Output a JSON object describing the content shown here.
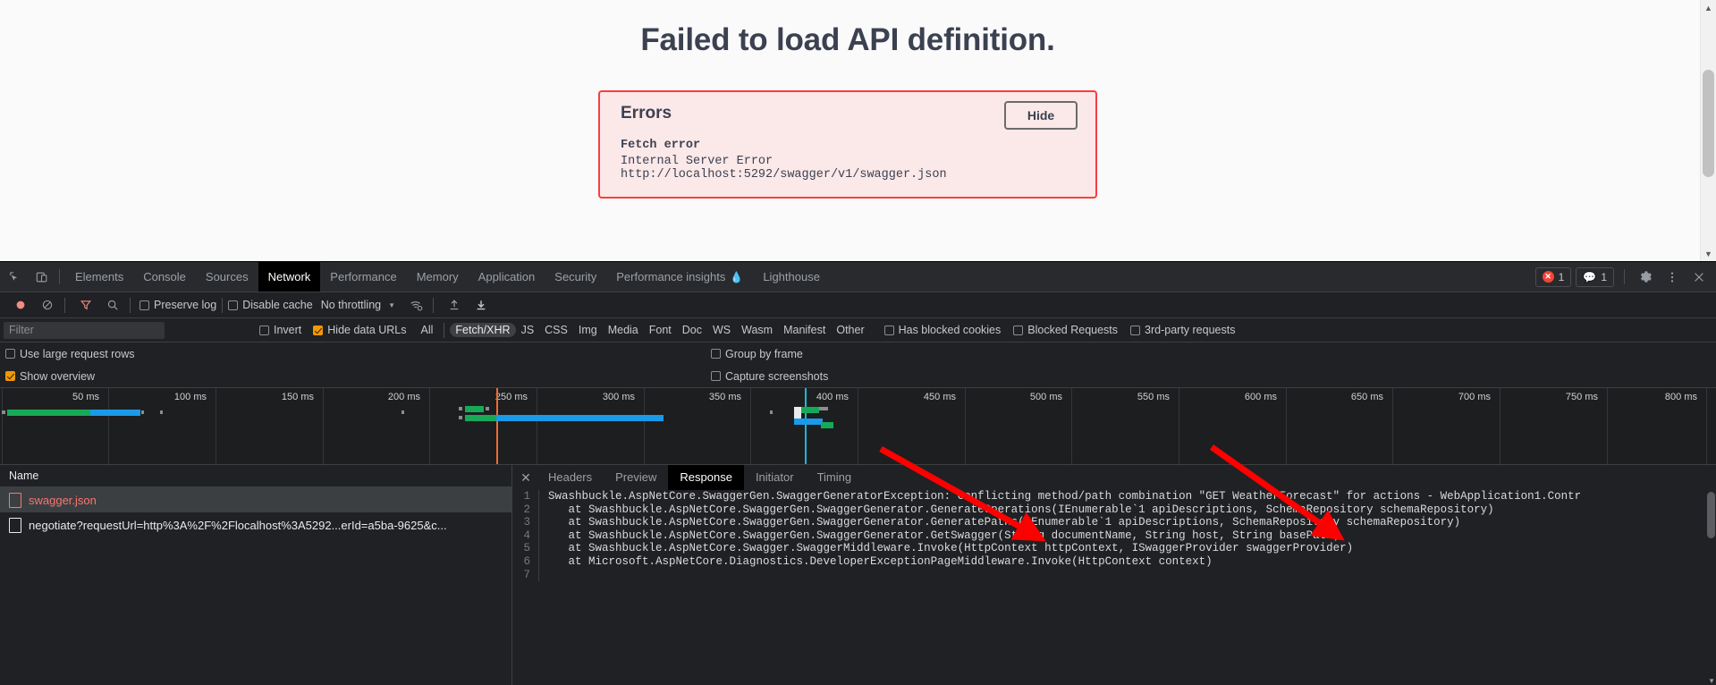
{
  "page": {
    "title": "Failed to load API definition.",
    "errors_panel": {
      "heading": "Errors",
      "hide_button": "Hide",
      "error_label": "Fetch error",
      "error_detail": "Internal Server Error http://localhost:5292/swagger/v1/swagger.json"
    }
  },
  "devtools": {
    "tabs": [
      {
        "label": "Elements",
        "active": false
      },
      {
        "label": "Console",
        "active": false
      },
      {
        "label": "Sources",
        "active": false
      },
      {
        "label": "Network",
        "active": true
      },
      {
        "label": "Performance",
        "active": false
      },
      {
        "label": "Memory",
        "active": false
      },
      {
        "label": "Application",
        "active": false
      },
      {
        "label": "Security",
        "active": false
      },
      {
        "label": "Performance insights",
        "active": false,
        "beaker": "⚗"
      },
      {
        "label": "Lighthouse",
        "active": false
      }
    ],
    "status": {
      "error_count": "1",
      "message_count": "1"
    },
    "network_toolbar": {
      "preserve_log": {
        "label": "Preserve log",
        "checked": false
      },
      "disable_cache": {
        "label": "Disable cache",
        "checked": false
      },
      "throttling": "No throttling"
    },
    "filter_bar": {
      "filter_placeholder": "Filter",
      "filter_value": "",
      "invert": {
        "label": "Invert",
        "checked": false
      },
      "hide_data_urls": {
        "label": "Hide data URLs",
        "checked": true
      },
      "types": [
        {
          "label": "All",
          "active": false
        },
        {
          "label": "Fetch/XHR",
          "active": true
        },
        {
          "label": "JS",
          "active": false
        },
        {
          "label": "CSS",
          "active": false
        },
        {
          "label": "Img",
          "active": false
        },
        {
          "label": "Media",
          "active": false
        },
        {
          "label": "Font",
          "active": false
        },
        {
          "label": "Doc",
          "active": false
        },
        {
          "label": "WS",
          "active": false
        },
        {
          "label": "Wasm",
          "active": false
        },
        {
          "label": "Manifest",
          "active": false
        },
        {
          "label": "Other",
          "active": false
        }
      ],
      "has_blocked_cookies": {
        "label": "Has blocked cookies",
        "checked": false
      },
      "blocked_requests": {
        "label": "Blocked Requests",
        "checked": false
      },
      "third_party_requests": {
        "label": "3rd-party requests",
        "checked": false
      }
    },
    "options": {
      "use_large_request_rows": {
        "label": "Use large request rows",
        "checked": false
      },
      "show_overview": {
        "label": "Show overview",
        "checked": true
      },
      "group_by_frame": {
        "label": "Group by frame",
        "checked": false
      },
      "capture_screenshots": {
        "label": "Capture screenshots",
        "checked": false
      }
    },
    "overview": {
      "ticks": [
        "50 ms",
        "100 ms",
        "150 ms",
        "200 ms",
        "250 ms",
        "300 ms",
        "350 ms",
        "400 ms",
        "450 ms",
        "500 ms",
        "550 ms",
        "600 ms",
        "650 ms",
        "700 ms",
        "750 ms",
        "800 ms"
      ]
    },
    "request_list": {
      "column_header": "Name",
      "rows": [
        {
          "name": "swagger.json",
          "selected": true,
          "error": true
        },
        {
          "name": "negotiate?requestUrl=http%3A%2F%2Flocalhost%3A5292...erId=a5ba-9625&c...",
          "selected": false,
          "error": false
        }
      ]
    },
    "detail_tabs": [
      {
        "label": "Headers",
        "active": false
      },
      {
        "label": "Preview",
        "active": false
      },
      {
        "label": "Response",
        "active": true
      },
      {
        "label": "Initiator",
        "active": false
      },
      {
        "label": "Timing",
        "active": false
      }
    ],
    "response_body": {
      "lines": [
        {
          "no": "1",
          "text": "Swashbuckle.AspNetCore.SwaggerGen.SwaggerGeneratorException: Conflicting method/path combination \"GET WeatherForecast\" for actions - WebApplication1.Contr"
        },
        {
          "no": "2",
          "text": "   at Swashbuckle.AspNetCore.SwaggerGen.SwaggerGenerator.GenerateOperations(IEnumerable`1 apiDescriptions, SchemaRepository schemaRepository)"
        },
        {
          "no": "3",
          "text": "   at Swashbuckle.AspNetCore.SwaggerGen.SwaggerGenerator.GeneratePaths(IEnumerable`1 apiDescriptions, SchemaRepository schemaRepository)"
        },
        {
          "no": "4",
          "text": "   at Swashbuckle.AspNetCore.SwaggerGen.SwaggerGenerator.GetSwagger(String documentName, String host, String basePath)"
        },
        {
          "no": "5",
          "text": "   at Swashbuckle.AspNetCore.Swagger.SwaggerMiddleware.Invoke(HttpContext httpContext, ISwaggerProvider swaggerProvider)"
        },
        {
          "no": "6",
          "text": "   at Microsoft.AspNetCore.Diagnostics.DeveloperExceptionPageMiddleware.Invoke(HttpContext context)"
        },
        {
          "no": "7",
          "text": ""
        }
      ]
    }
  },
  "colors": {
    "error_red": "#f93e3e",
    "error_bg": "#fbe8e8",
    "annotation_arrow": "#ff0000",
    "accent_orange": "#f29900",
    "waterfall_green": "#18a957",
    "waterfall_blue": "#1a9ae8"
  }
}
